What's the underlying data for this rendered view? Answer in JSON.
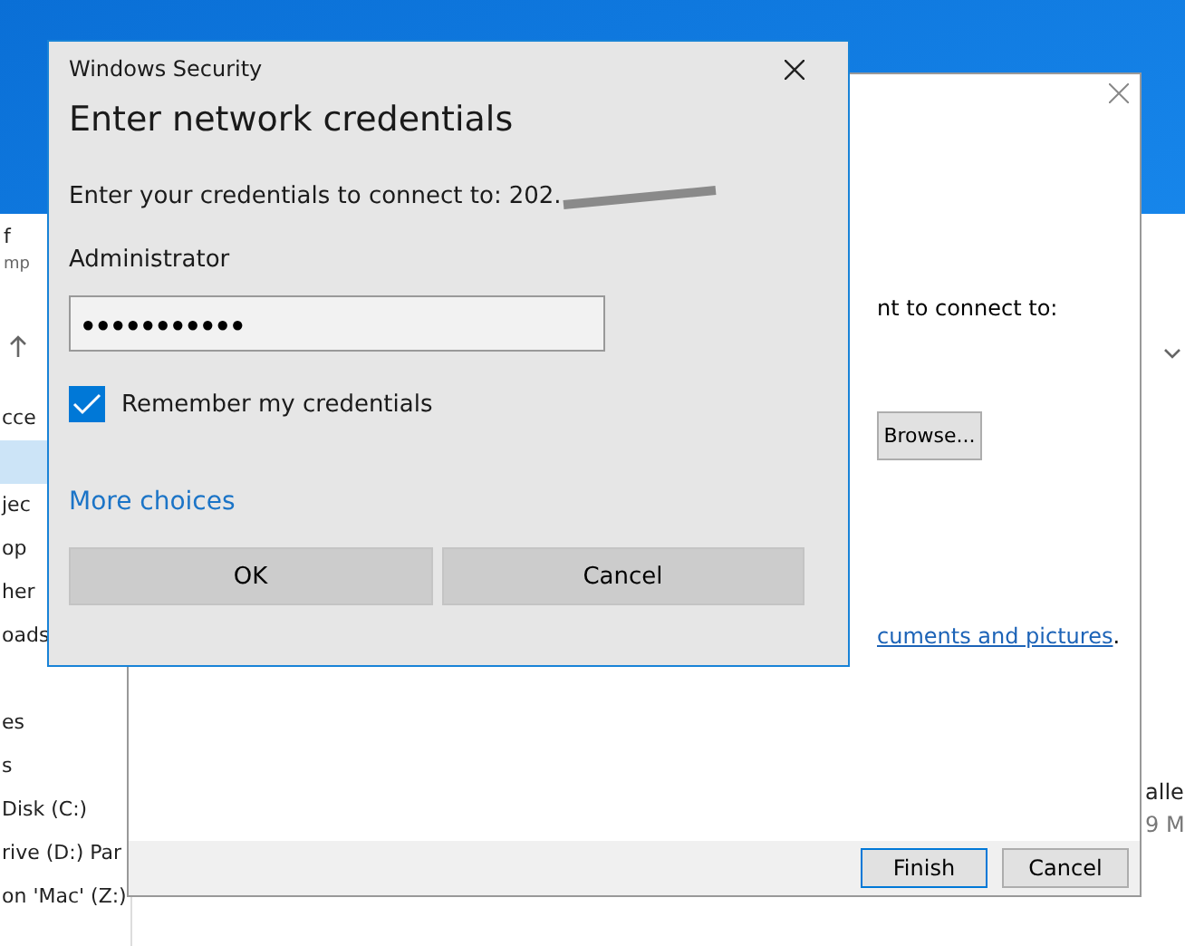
{
  "explorer": {
    "header_fragments": [
      "f",
      "mp"
    ],
    "sidebar_items": [
      {
        "label": "cce",
        "selected": false
      },
      {
        "selected": true
      },
      {
        "label": "jec",
        "selected": false
      },
      {
        "label": "op",
        "selected": false
      },
      {
        "label": "her",
        "selected": false
      },
      {
        "label": "oads",
        "selected": false
      },
      {
        "label": "es",
        "selected": false
      },
      {
        "label": "s",
        "selected": false
      },
      {
        "label": "Disk (C:)",
        "selected": false
      },
      {
        "label": "rive (D:) Par",
        "selected": false
      },
      {
        "label": "on 'Mac' (Z:)",
        "selected": false
      }
    ],
    "column_fragments": [
      "alle",
      "9 M"
    ]
  },
  "wizard": {
    "text_fragment": "nt to connect to:",
    "browse_button": "Browse...",
    "link_fragment": "cuments and pictures",
    "link_suffix": ".",
    "buttons": [
      {
        "label": "Finish",
        "default": true
      },
      {
        "label": "Cancel",
        "default": false
      }
    ]
  },
  "security_dialog": {
    "title": "Windows Security",
    "heading": "Enter network credentials",
    "prompt": "Enter your credentials to connect to:",
    "address_visible": "202.",
    "username": "Administrator",
    "password": "●●●●●●●●●●●",
    "remember_credentials": {
      "label": "Remember my credentials",
      "checked": true
    },
    "more_choices": "More choices",
    "buttons": [
      "OK",
      "Cancel"
    ]
  }
}
